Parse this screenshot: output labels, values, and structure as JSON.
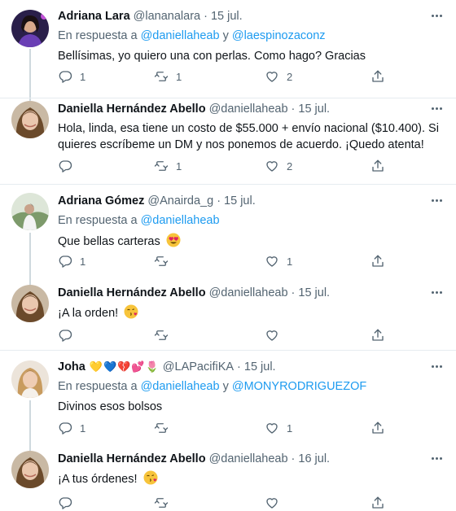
{
  "tweets": [
    {
      "name": "Adriana Lara",
      "handle": "@lananalara",
      "date": "15 jul.",
      "reply_prefix": "En respuesta a",
      "mentions": [
        "@daniellaheab",
        "@laespinozaconz"
      ],
      "mention_sep": "y",
      "text": "Bellísimas, yo quiero una con perlas. Como hago? Gracias",
      "replies": "1",
      "retweets": "1",
      "likes": "2"
    },
    {
      "name": "Daniella Hernández Abello",
      "handle": "@daniellaheab",
      "date": "15 jul.",
      "text": "Hola, linda, esa tiene un costo de $55.000 + envío nacional ($10.400). Si quieres escríbeme un DM y nos ponemos de acuerdo. ¡Quedo atenta!",
      "replies": "",
      "retweets": "1",
      "likes": "2"
    },
    {
      "name": "Adriana Gómez",
      "handle": "@Anairda_g",
      "date": "15 jul.",
      "reply_prefix": "En respuesta a",
      "mentions": [
        "@daniellaheab"
      ],
      "text": "Que bellas carteras",
      "text_emoji": "heart-eyes-emoji",
      "replies": "1",
      "retweets": "",
      "likes": "1"
    },
    {
      "name": "Daniella Hernández Abello",
      "handle": "@daniellaheab",
      "date": "15 jul.",
      "text": "¡A la orden!",
      "text_emoji": "kiss-emoji",
      "replies": "",
      "retweets": "",
      "likes": ""
    },
    {
      "name": "Joha",
      "name_emojis": "💛💙💔💕🌷",
      "handle": "@LAPacifiKA",
      "date": "15 jul.",
      "reply_prefix": "En respuesta a",
      "mentions": [
        "@daniellaheab",
        "@MONYRODRIGUEZOF"
      ],
      "mention_sep": "y",
      "text": "Divinos esos bolsos",
      "replies": "1",
      "retweets": "",
      "likes": "1"
    },
    {
      "name": "Daniella Hernández Abello",
      "handle": "@daniellaheab",
      "date": "16 jul.",
      "text": "¡A tus órdenes!",
      "text_emoji": "kiss-emoji",
      "replies": "",
      "retweets": "",
      "likes": ""
    }
  ],
  "colors": {
    "text": "#0f1419",
    "secondary": "#536471",
    "link": "#1d9bf0",
    "divider": "#e6ecf0",
    "thread_line": "#cfd9de"
  },
  "icons": [
    "reply-icon",
    "retweet-icon",
    "like-icon",
    "share-icon",
    "more-icon"
  ]
}
